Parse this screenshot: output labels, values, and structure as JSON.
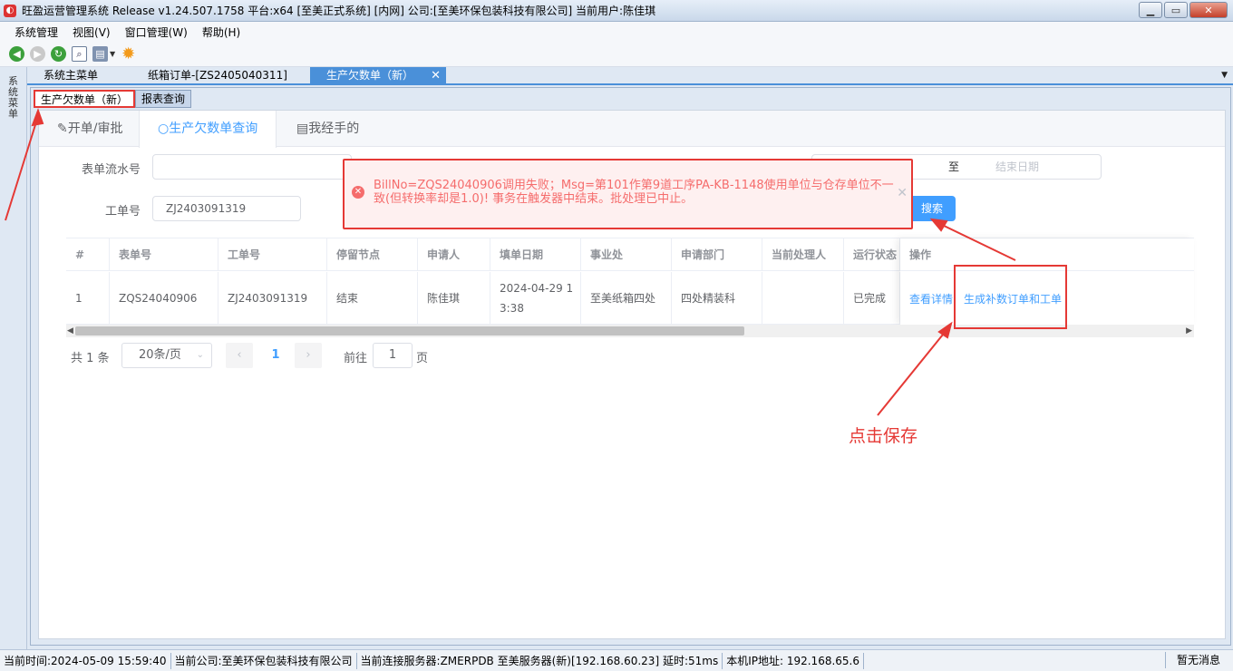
{
  "window": {
    "title": "旺盈运营管理系统 Release v1.24.507.1758 平台:x64  [至美正式系统] [内网] 公司:[至美环保包装科技有限公司] 当前用户:陈佳琪",
    "minimize": "▁",
    "maximize": "▭",
    "close": "✕"
  },
  "menu": [
    "系统管理",
    "视图(V)",
    "窗口管理(W)",
    "帮助(H)"
  ],
  "left_menu_label": "系统菜单",
  "doc_tabs": [
    {
      "label": "系统主菜单"
    },
    {
      "label": "纸箱订单-[ZS2405040311]"
    },
    {
      "label": "生产欠数单（新）",
      "close": "✕"
    }
  ],
  "sub_tabs": [
    {
      "label": "生产欠数单（新）"
    },
    {
      "label": "报表查询"
    }
  ],
  "content_tabs": [
    {
      "icon": "edit-icon",
      "label": "✎开单/审批"
    },
    {
      "icon": "search-icon",
      "label": "○生产欠数单查询"
    },
    {
      "icon": "document-icon",
      "label": "▤我经手的"
    }
  ],
  "form": {
    "serial_label": "表单流水号",
    "serial_value": "",
    "date_to": "至",
    "date_end_placeholder": "结束日期",
    "job_label": "工单号",
    "job_value": "ZJ2403091319",
    "search_button": "搜索"
  },
  "table": {
    "headers": [
      "#",
      "表单号",
      "工单号",
      "停留节点",
      "申请人",
      "填单日期",
      "事业处",
      "申请部门",
      "当前处理人",
      "运行状态",
      "操作"
    ],
    "rows": [
      {
        "idx": "1",
        "bill_no": "ZQS24040906",
        "job_no": "ZJ2403091319",
        "node": "结束",
        "applicant": "陈佳琪",
        "date_line1": "2024-04-29 1",
        "date_line2": "3:38",
        "division": "至美纸箱四处",
        "dept": "四处精装科",
        "handler": "",
        "status": "已完成",
        "action_detail": "查看详情",
        "action_generate": "生成补数订单和工单"
      }
    ]
  },
  "pager": {
    "total": "共 1 条",
    "page_size": "20条/页",
    "prev": "‹",
    "current": "1",
    "next": "›",
    "goto_label": "前往",
    "goto_value": "1",
    "page_suffix": "页"
  },
  "error_message": "BillNo=ZQS24040906调用失败；Msg=第101作第9道工序PA-KB-1148使用单位与仓存单位不一致(但转换率却是1.0)! 事务在触发器中结束。批处理已中止。",
  "annotation": "点击保存",
  "status_bar": {
    "time": "当前时间:2024-05-09 15:59:40",
    "company": "当前公司:至美环保包装科技有限公司",
    "server": "当前连接服务器:ZMERPDB 至美服务器(新)[192.168.60.23] 延时:51ms",
    "ip": "本机IP地址: 192.168.65.6",
    "message": "暂无消息"
  },
  "colors": {
    "accent": "#409eff",
    "error": "#f56c6c",
    "highlight": "#e53935",
    "tab_active": "#4a90d9"
  }
}
